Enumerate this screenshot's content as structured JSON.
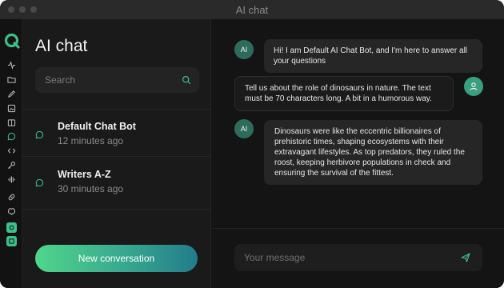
{
  "window": {
    "title": "AI chat"
  },
  "rail": {
    "icons": [
      "logo-icon",
      "activity-icon",
      "folder-icon",
      "pencil-icon",
      "image-icon",
      "book-icon",
      "chat-icon",
      "code-icon",
      "key-icon",
      "audio-icon",
      "link-icon",
      "brain-icon",
      "settings-icon",
      "profile-icon"
    ]
  },
  "sidebar": {
    "title": "AI chat",
    "search": {
      "placeholder": "Search"
    },
    "conversations": [
      {
        "name": "Default Chat Bot",
        "time": "12 minutes ago"
      },
      {
        "name": "Writers A-Z",
        "time": "30 minutes ago"
      }
    ],
    "new_button": "New conversation"
  },
  "chat": {
    "messages": [
      {
        "role": "bot",
        "avatar": "AI",
        "text": "Hi! I am Default AI Chat Bot, and I'm here to answer all your questions"
      },
      {
        "role": "user",
        "text": "Tell us about the role of dinosaurs in nature. The text must be 70 characters long. A bit in a humorous way."
      },
      {
        "role": "bot",
        "avatar": "AI",
        "text": "Dinosaurs were like the eccentric billionaires of prehistoric times, shaping ecosystems with their extravagant lifestyles. As top predators, they ruled the roost, keeping herbivore populations in check and ensuring the survival of the fittest."
      }
    ],
    "composer": {
      "placeholder": "Your message"
    }
  },
  "colors": {
    "accent": "#3fbf8a",
    "background": "#141414",
    "sidebar": "#1a1a1a",
    "bubble": "#262626"
  }
}
